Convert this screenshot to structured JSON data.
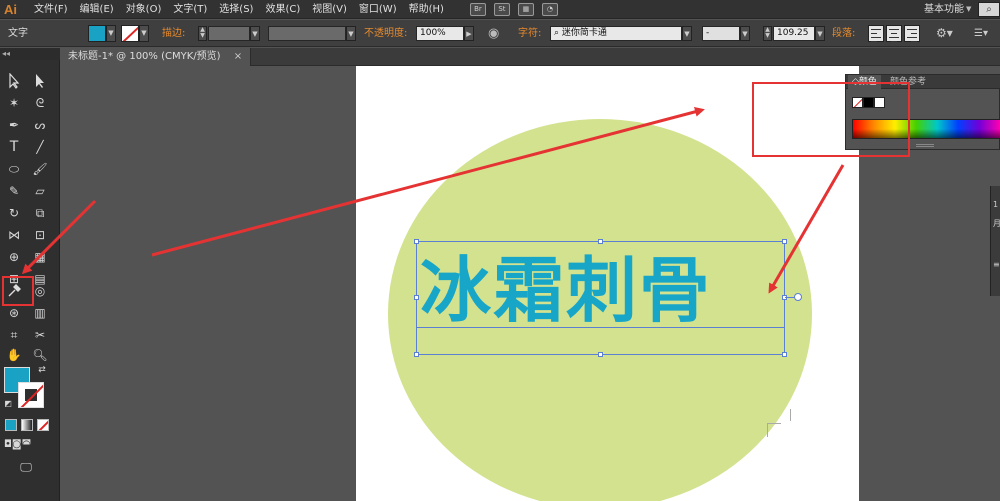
{
  "app": {
    "logo_text": "Ai",
    "menu": [
      "文件(F)",
      "编辑(E)",
      "对象(O)",
      "文字(T)",
      "选择(S)",
      "效果(C)",
      "视图(V)",
      "窗口(W)",
      "帮助(H)"
    ],
    "menubar_icons": [
      "bridge-icon",
      "stock-icon",
      "arrange-documents-icon",
      "gpu-performance-icon"
    ],
    "menubar_icon_labels": {
      "bridge": "Br",
      "stock": "St"
    },
    "workspace": "基本功能",
    "search_glyph": "⌕"
  },
  "control_bar": {
    "context_label": "文字",
    "fill_color": "#1aa2c4",
    "stroke_label": "描边:",
    "opacity_label": "不透明度:",
    "opacity_value": "100%",
    "character_label": "字符:",
    "font_name": "迷你简卡通",
    "font_style": "-",
    "font_size": "109.25",
    "paragraph_label": "段落:"
  },
  "document_tab": {
    "title": "未标题-1* @ 100% (CMYK/预览)",
    "close_glyph": "×"
  },
  "tools_panel": {
    "collapse_glyph": "◂◂",
    "fill_color": "#1aa2c4",
    "stroke_color": "#ffffff"
  },
  "artwork": {
    "text": "冰霜刺骨",
    "text_color": "#18a6c8",
    "circle_color": "#d2e28f"
  },
  "color_panel": {
    "tab_color": "颜色",
    "tab_guide": "颜色参考"
  },
  "right_strip": {
    "glyphs": [
      "1",
      "月",
      "≡"
    ]
  },
  "annotation_color": "#e53333"
}
